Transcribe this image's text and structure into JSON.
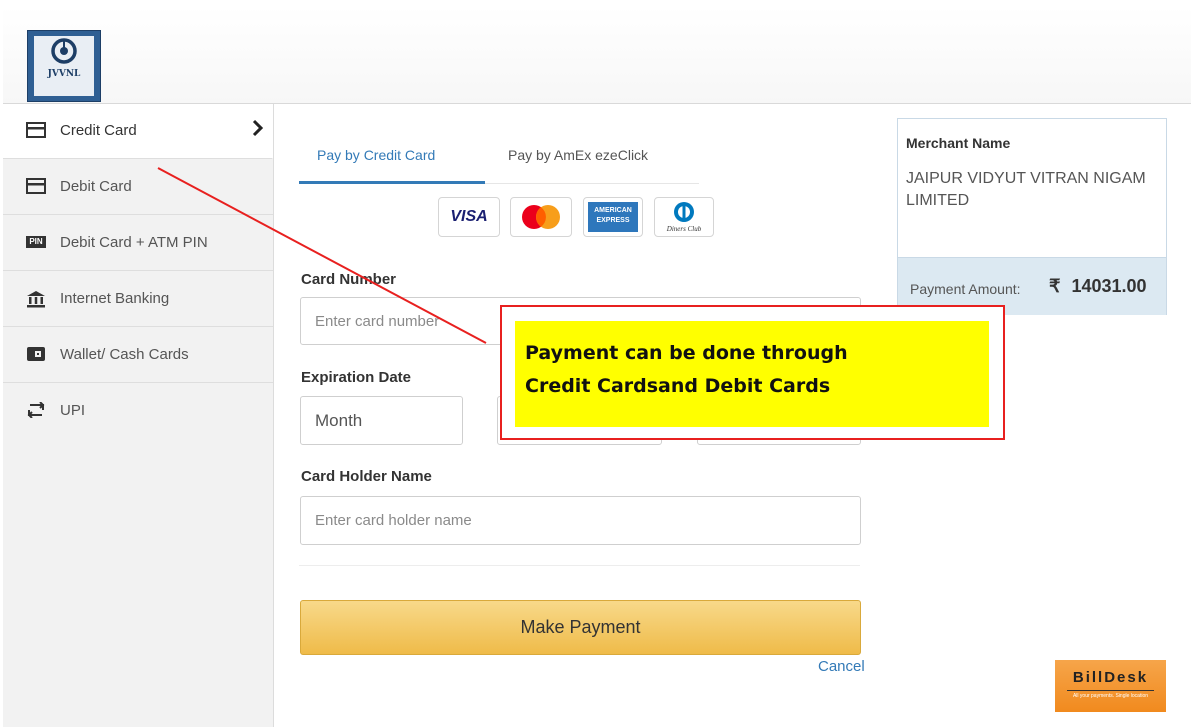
{
  "header": {
    "logo_text": "JVVNL"
  },
  "sidebar": {
    "items": [
      {
        "label": "Credit Card",
        "icon": "credit-card-icon",
        "active": true
      },
      {
        "label": "Debit Card",
        "icon": "debit-card-icon"
      },
      {
        "label": "Debit Card + ATM PIN",
        "icon": "pin-icon",
        "icon_text": "PIN"
      },
      {
        "label": "Internet Banking",
        "icon": "bank-icon"
      },
      {
        "label": "Wallet/ Cash Cards",
        "icon": "wallet-icon"
      },
      {
        "label": "UPI",
        "icon": "upi-icon"
      }
    ]
  },
  "tabs": [
    {
      "label": "Pay by Credit Card",
      "active": true
    },
    {
      "label": "Pay by AmEx ezeClick",
      "active": false
    }
  ],
  "card_logos": [
    {
      "name": "visa-logo",
      "text": "VISA"
    },
    {
      "name": "mastercard-logo",
      "text": ""
    },
    {
      "name": "amex-logo",
      "text": "AMERICAN EXPRESS"
    },
    {
      "name": "diners-club-logo",
      "text": "Diners Club"
    }
  ],
  "form": {
    "card_number_label": "Card Number",
    "card_number_placeholder": "Enter card number",
    "expiration_label": "Expiration Date",
    "month_value": "Month",
    "holder_label": "Card Holder Name",
    "holder_placeholder": "Enter card holder name",
    "pay_button": "Make Payment",
    "cancel": "Cancel"
  },
  "merchant": {
    "title": "Merchant Name",
    "name": "JAIPUR VIDYUT VITRAN NIGAM LIMITED",
    "amount_label": "Payment Amount:",
    "currency_symbol": "₹",
    "amount": "14031.00"
  },
  "billdesk": {
    "brand": "BillDesk",
    "tagline": "All your payments. Single location"
  },
  "annotation": {
    "line1": "Payment can be done through",
    "line2": "Credit Cardsand Debit Cards",
    "color_border": "#e8201f",
    "color_fill": "#ffff00"
  },
  "colors": {
    "link": "#337ab7",
    "button_top": "#f8d98a",
    "button_bottom": "#efbb49"
  }
}
